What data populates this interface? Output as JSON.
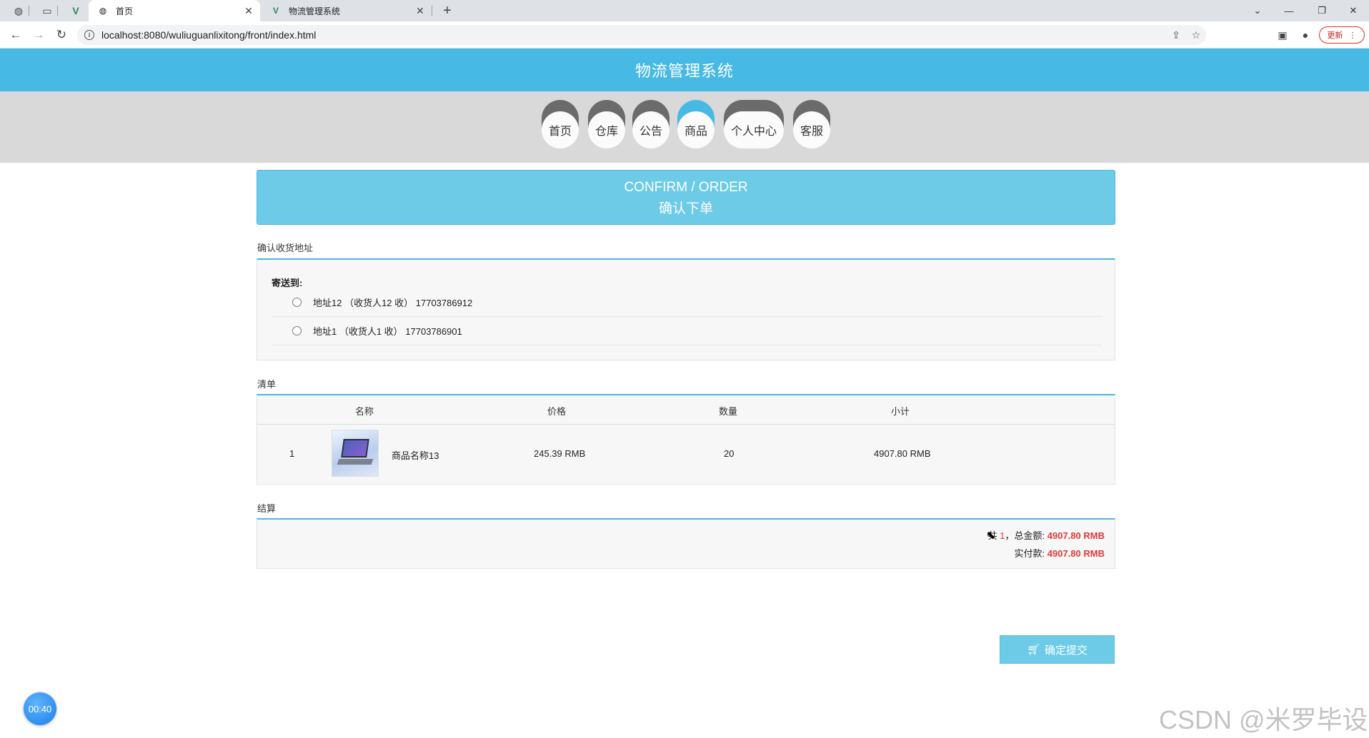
{
  "browser": {
    "tabs": [
      {
        "title": "首页",
        "active": true
      },
      {
        "title": "物流管理系统",
        "active": false
      }
    ],
    "new_tab_icon": "plus-icon",
    "url": "localhost:8080/wuliuguanlixitong/front/index.html",
    "update_label": "更新"
  },
  "header": {
    "title": "物流管理系统"
  },
  "nav": {
    "items": [
      {
        "label": "首页"
      },
      {
        "label": "仓库"
      },
      {
        "label": "公告"
      },
      {
        "label": "商品"
      },
      {
        "label": "个人中心"
      },
      {
        "label": "客服"
      }
    ],
    "active": "商品"
  },
  "banner": {
    "en": "CONFIRM / ORDER",
    "zh": "确认下单"
  },
  "address_section": {
    "title": "确认收货地址",
    "ship_to": "寄送到:",
    "addresses": [
      {
        "text": "地址12 （收货人12 收） 17703786912"
      },
      {
        "text": "地址1 （收货人1 收） 17703786901"
      }
    ]
  },
  "list_section": {
    "title": "清单",
    "columns": [
      "名称",
      "价格",
      "数量",
      "小计"
    ],
    "rows": [
      {
        "index": "1",
        "name": "商品名称13",
        "price": "245.39 RMB",
        "qty": "20",
        "subtotal": "4907.80 RMB"
      }
    ]
  },
  "settle_section": {
    "title": "结算",
    "prefix": "共",
    "count": "1",
    "total_label": "，总金额:",
    "total": "4907.80 RMB",
    "paid_label": "实付款:",
    "paid": "4907.80 RMB"
  },
  "submit": {
    "label": "确定提交"
  },
  "overlay": {
    "timer": "00:40",
    "watermark": "CSDN @米罗毕设"
  },
  "colors": {
    "accent": "#46b9e4",
    "banner": "#6dcbe8",
    "price_red": "#e4393c",
    "nav_inactive": "#6b6b6b"
  }
}
